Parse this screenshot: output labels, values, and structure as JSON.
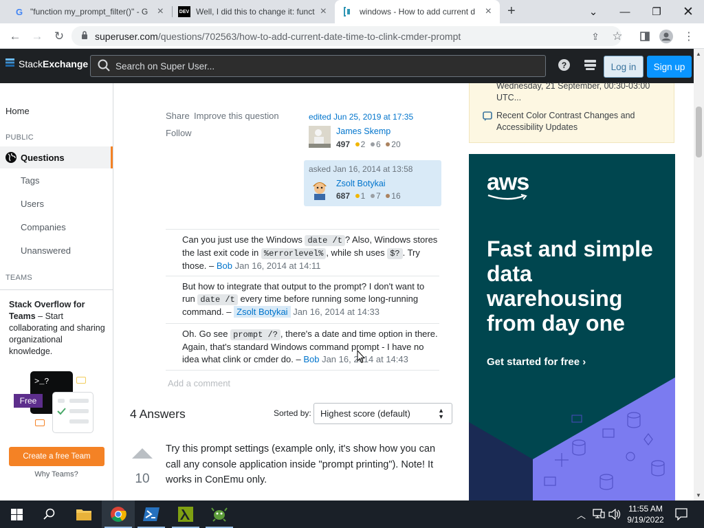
{
  "browser": {
    "tabs": [
      {
        "label": "\"function my_prompt_filter()\" - G",
        "favicon": "G"
      },
      {
        "label": "Well, I did this to change it: funct",
        "favicon": "DEV"
      },
      {
        "label": "windows - How to add current d",
        "favicon": "SU"
      }
    ],
    "new_tab": "+",
    "url_host": "superuser.com",
    "url_path": "/questions/702563/how-to-add-current-date-time-to-clink-cmder-prompt"
  },
  "se_header": {
    "logo_part1": "Stack",
    "logo_part2": "Exchange",
    "search_placeholder": "Search on Super User...",
    "login": "Log in",
    "signup": "Sign up"
  },
  "leftnav": {
    "home": "Home",
    "public": "PUBLIC",
    "questions": "Questions",
    "tags": "Tags",
    "users": "Users",
    "companies": "Companies",
    "unanswered": "Unanswered",
    "teams": "TEAMS",
    "teams_title": "Stack Overflow for Teams",
    "teams_desc": " – Start collaborating and sharing organizational knowledge.",
    "free_badge": "Free",
    "terminal_prompt": ">_?",
    "create_team": "Create a free Team",
    "why_teams": "Why Teams?"
  },
  "post_menu": {
    "share": "Share",
    "improve": "Improve this question",
    "follow": "Follow"
  },
  "edited": {
    "label": "edited Jun 25, 2019 at 17:35",
    "user": "James Skemp",
    "rep": "497",
    "gold": "2",
    "silver": "6",
    "bronze": "20"
  },
  "asked": {
    "label": "asked Jan 16, 2014 at 13:58",
    "user": "Zsolt Botykai",
    "rep": "687",
    "gold": "1",
    "silver": "7",
    "bronze": "16"
  },
  "comments": [
    {
      "t1": "Can you just use the Windows ",
      "c1": "date /t",
      "t2": "? Also, Windows stores the last exit code in ",
      "c2": "%errorlevel%",
      "t3": ", while sh uses ",
      "c3": "$?",
      "t4": ". Try those. – ",
      "user": "Bob",
      "date": "Jan 16, 2014 at 14:11"
    },
    {
      "t1": "But how to integrate that output to the prompt? I don't want to run ",
      "c1": "date /t",
      "t2": " every time before running some long-running command. – ",
      "user": "Zsolt Botykai",
      "date": "Jan 16, 2014 at 14:33"
    },
    {
      "t1": "Oh. Go see ",
      "c1": "prompt /?",
      "t2": ", there's a date and time option in there. Again, that's standard Windows command prompt - I have no idea what clink or cmder do. – ",
      "user": "Bob",
      "date": "Jan 16, 2014 at 14:43"
    }
  ],
  "add_comment": "Add a comment",
  "answers": {
    "count_label": "4 Answers",
    "sorted_by": "Sorted by:",
    "sort_value": "Highest score (default)",
    "first_score": "10",
    "first_text": "Try this prompt settings (example only, it's show how you can call any console application inside \"prompt printing\"). Note! It works in ConEmu only."
  },
  "sidebar_right": {
    "meta_date": "Wednesday, 21 September, 00:30-03:00 UTC...",
    "meta_link": "Recent Color Contrast Changes and Accessibility Updates"
  },
  "ad": {
    "brand": "aws",
    "headline": "Fast and simple data warehousing from day one",
    "cta": "Get started for free ›"
  },
  "taskbar": {
    "time": "11:55 AM",
    "date": "9/19/2022"
  },
  "colors": {
    "accent_orange": "#f48225",
    "link_blue": "#0074cc",
    "ad_teal": "#00464f",
    "ad_purple": "#7b7bf0"
  }
}
